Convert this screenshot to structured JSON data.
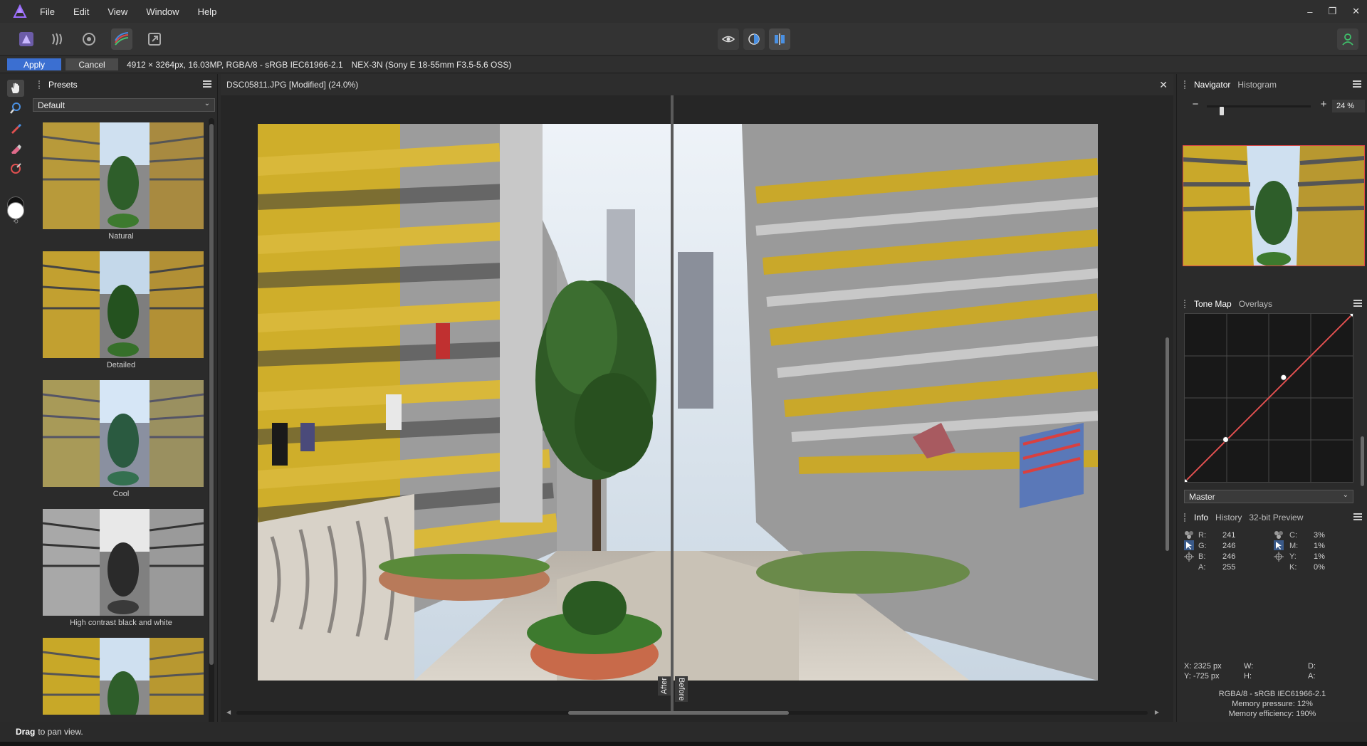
{
  "menu": {
    "items": [
      "File",
      "Edit",
      "View",
      "Window",
      "Help"
    ]
  },
  "window_controls": {
    "minimize": "–",
    "restore": "❐",
    "close": "✕"
  },
  "context": {
    "apply": "Apply",
    "cancel": "Cancel",
    "image_info": "4912 × 3264px, 16.03MP, RGBA/8 - sRGB IEC61966-2.1",
    "camera": "NEX-3N (Sony E 18-55mm F3.5-5.6 OSS)"
  },
  "presets": {
    "tab": "Presets",
    "selected": "Default",
    "items": [
      "Natural",
      "Detailed",
      "Cool",
      "High contrast black and white"
    ]
  },
  "document": {
    "title": "DSC05811.JPG [Modified] (24.0%)",
    "split_after": "After",
    "split_before": "Before"
  },
  "navigator": {
    "tabs": [
      "Navigator",
      "Histogram"
    ],
    "zoom": "24 %",
    "zoom_level": 0.24
  },
  "tonemap": {
    "tabs": [
      "Tone Map",
      "Overlays"
    ],
    "channel": "Master"
  },
  "info": {
    "tabs": [
      "Info",
      "History",
      "32-bit Preview"
    ],
    "rgb": [
      {
        "k": "R:",
        "v": "241"
      },
      {
        "k": "G:",
        "v": "246"
      },
      {
        "k": "B:",
        "v": "246"
      },
      {
        "k": "A:",
        "v": "255"
      }
    ],
    "cmyk": [
      {
        "k": "C:",
        "v": "3%"
      },
      {
        "k": "M:",
        "v": "1%"
      },
      {
        "k": "Y:",
        "v": "1%"
      },
      {
        "k": "K:",
        "v": "0%"
      }
    ],
    "x": "X: 2325 px",
    "y": "Y: -725 px",
    "w": "W:",
    "h": "H:",
    "d": "D:",
    "a": "A:",
    "color_format": "RGBA/8 - sRGB IEC61966-2.1",
    "memory_pressure": "Memory pressure: 12%",
    "memory_efficiency": "Memory efficiency: 190%"
  },
  "status": {
    "bold": "Drag",
    "text": "to pan view."
  },
  "colors": {
    "accent": "#3b6fd1",
    "logo": "#8a5cf6",
    "account": "#3fbf6a"
  }
}
